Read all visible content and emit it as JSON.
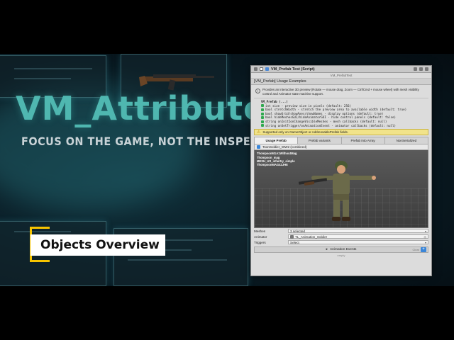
{
  "overlay": {
    "label": "Objects Overview"
  },
  "hero": {
    "title": "VM_Attributes",
    "subtitle": "FOCUS ON THE GAME, NOT THE INSPECTOR"
  },
  "inspector": {
    "window_title": "VM_Prefab Test (Script)",
    "script_field": "VM_PrefabTest",
    "section_title": "[VM_Prefab] Usage Examples",
    "help_text": "Provides an interactive 3D preview (Rotate — mouse drag, Zoom — Ctrl/Cmd + mouse wheel) with mesh visibility control and Animator state machine support.",
    "code_header": "VM_Prefab (...)",
    "code_lines": [
      "int size - preview size in pixels (default: 256)",
      "bool stretchWidth - stretch the preview area to available width (default: true)",
      "bool showGrid/showAxes/showNames - display options (default: true)",
      "bool hideMeshesGUI/hideAnimatorGUI - hide control panels (default: false)",
      "string onInitIonChangeVisibleMeshes - mesh callbacks (default: null)",
      "string onSetTrigger/onAnimationEvent - animator callbacks (default: null)"
    ],
    "warning": "Supported only on GameObject or AddressablePrefab fields.",
    "tabs": [
      "Usage Prefab",
      "Prefab variants",
      "Prefab into Array",
      "NonSerialized"
    ],
    "object_name": "ToonSoldier_WW2 (combined)",
    "preview_labels": [
      "ThompsonM1A1WithoutMag",
      "Thompson_mag",
      "MESH_US_infantry_simple",
      "ThompsonMAG42JHE"
    ],
    "meshes_label": "Meshes",
    "meshes_value": "3 selected",
    "animator_label": "Animator",
    "animator_value": "TL_Animation_Soldier",
    "triggers_label": "Triggers",
    "triggers_value": "Select",
    "anim_events_label": "Animation Events",
    "anim_events_clear": "Clear",
    "empty_text": "empty"
  },
  "colors": {
    "title": "#4fb7b0",
    "badge_accent": "#f6c400",
    "warning_bg": "#f1e38a"
  }
}
